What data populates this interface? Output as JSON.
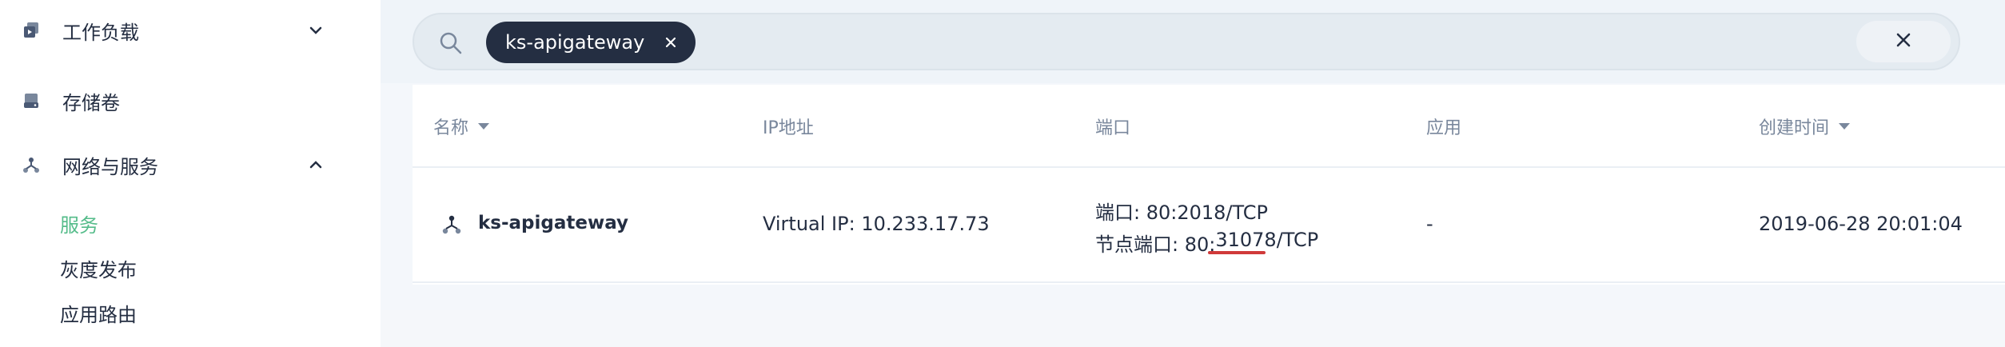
{
  "sidebar": {
    "groups": [
      {
        "label": "工作负载",
        "icon": "workload-icon",
        "expanded": false
      },
      {
        "label": "存储卷",
        "icon": "storage-volume-icon"
      },
      {
        "label": "网络与服务",
        "icon": "network-topology-icon",
        "expanded": true
      }
    ],
    "sub_items": [
      {
        "label": "服务",
        "active": true
      },
      {
        "label": "灰度发布",
        "active": false
      },
      {
        "label": "应用路由",
        "active": false
      }
    ]
  },
  "search": {
    "icon": "search-icon",
    "filter_tag": "ks-apigateway",
    "clear_icon": "close-icon"
  },
  "table": {
    "headers": {
      "name": "名称",
      "ip": "IP地址",
      "port": "端口",
      "app": "应用",
      "created": "创建时间"
    },
    "rows": [
      {
        "name": "ks-apigateway",
        "icon": "service-topology-icon",
        "ip": "Virtual IP: 10.233.17.73",
        "port_line1": "端口: 80:2018/TCP",
        "port_line2_prefix": "节点端口: 80:",
        "port_line2_highlight": "31078",
        "port_line2_suffix": "/TCP",
        "app": "-",
        "created": "2019-06-28 20:01:04"
      }
    ]
  },
  "colors": {
    "accent_green": "#55bc8a",
    "tag_dark": "#242e42",
    "annotation_red": "#d03a3a"
  }
}
